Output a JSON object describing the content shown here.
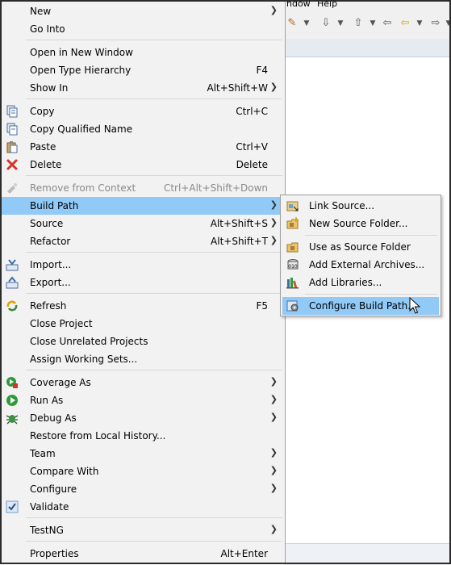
{
  "background": {
    "menu_window": "ndow",
    "menu_help": "Help"
  },
  "context_menu": {
    "new": "New",
    "go_into": "Go Into",
    "open_new_window": "Open in New Window",
    "open_type_hierarchy": "Open Type Hierarchy",
    "open_type_hierarchy_acc": "F4",
    "show_in": "Show In",
    "show_in_acc": "Alt+Shift+W",
    "copy": "Copy",
    "copy_acc": "Ctrl+C",
    "copy_qualified": "Copy Qualified Name",
    "paste": "Paste",
    "paste_acc": "Ctrl+V",
    "delete": "Delete",
    "delete_acc": "Delete",
    "remove_context": "Remove from Context",
    "remove_context_acc": "Ctrl+Alt+Shift+Down",
    "build_path": "Build Path",
    "source": "Source",
    "source_acc": "Alt+Shift+S",
    "refactor": "Refactor",
    "refactor_acc": "Alt+Shift+T",
    "import": "Import...",
    "export": "Export...",
    "refresh": "Refresh",
    "refresh_acc": "F5",
    "close_project": "Close Project",
    "close_unrelated": "Close Unrelated Projects",
    "assign_working_sets": "Assign Working Sets...",
    "coverage_as": "Coverage As",
    "run_as": "Run As",
    "debug_as": "Debug As",
    "restore_history": "Restore from Local History...",
    "team": "Team",
    "compare_with": "Compare With",
    "configure": "Configure",
    "validate": "Validate",
    "testng": "TestNG",
    "properties": "Properties",
    "properties_acc": "Alt+Enter"
  },
  "submenu": {
    "link_source": "Link Source...",
    "new_source_folder": "New Source Folder...",
    "use_as_source_folder": "Use as Source Folder",
    "add_external_archives": "Add External Archives...",
    "add_libraries": "Add Libraries...",
    "configure_build_path": "Configure Build Path..."
  },
  "colors": {
    "highlight": "#91c9f7",
    "menu_bg": "#f2f2f2",
    "disabled_text": "#8a8a8a"
  }
}
